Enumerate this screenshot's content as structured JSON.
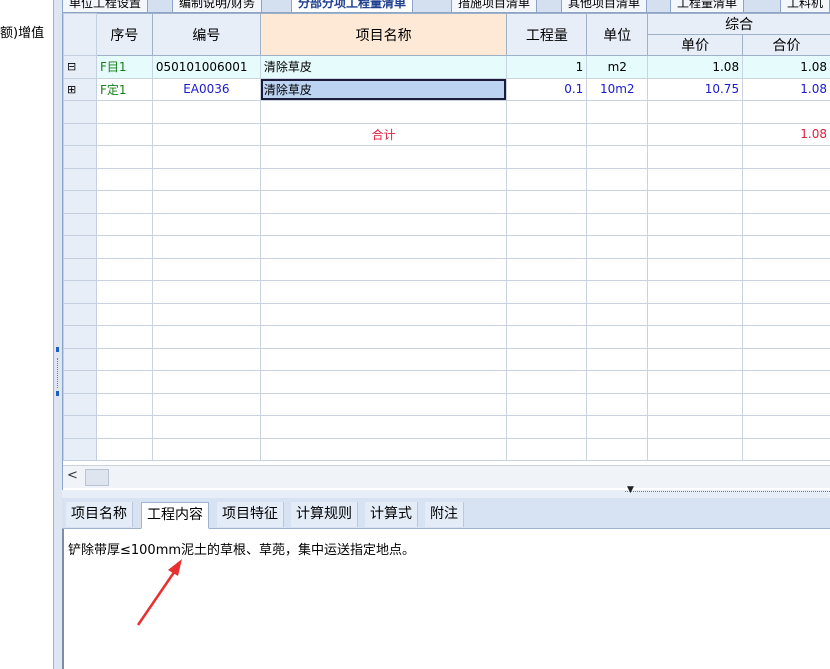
{
  "left_panel": {
    "label": "额)增值"
  },
  "top_tabs": [
    {
      "label": "单位工程设置"
    },
    {
      "label": "编制说明/财务"
    },
    {
      "label": "分部分项工程量清单"
    },
    {
      "label": "措施项目清单"
    },
    {
      "label": "其他项目清单"
    },
    {
      "label": "工程量清单"
    },
    {
      "label": "工料机"
    }
  ],
  "grid": {
    "headers": {
      "seq": "序号",
      "code": "编号",
      "name": "项目名称",
      "qty": "工程量",
      "unit": "单位",
      "composite": "综合",
      "unit_price": "单价",
      "total_price": "合价"
    },
    "rows": [
      {
        "tree": "⊟",
        "seq": "F目1",
        "code": "050101006001",
        "name": "清除草皮",
        "qty": "1",
        "unit": "m2",
        "unit_price": "1.08",
        "total_price": "1.08"
      },
      {
        "tree": "⊞",
        "seq": "F定1",
        "code": "EA0036",
        "name": "清除草皮",
        "qty": "0.1",
        "unit": "10m2",
        "unit_price": "10.75",
        "total_price": "1.08"
      }
    ],
    "total": {
      "label": "合计",
      "total_price": "1.08"
    },
    "scroll_left": "<"
  },
  "bottom_tabs": [
    {
      "label": "项目名称"
    },
    {
      "label": "工程内容"
    },
    {
      "label": "项目特征"
    },
    {
      "label": "计算规则"
    },
    {
      "label": "计算式"
    },
    {
      "label": "附注"
    }
  ],
  "work_content": "铲除带厚≤100mm泥土的草根、草蔸，集中运送指定地点。",
  "colors": {
    "accent_red": "#e02040",
    "green_text": "#17801b",
    "blue_text": "#1a1ad0",
    "selection": "#bcd3f2"
  }
}
